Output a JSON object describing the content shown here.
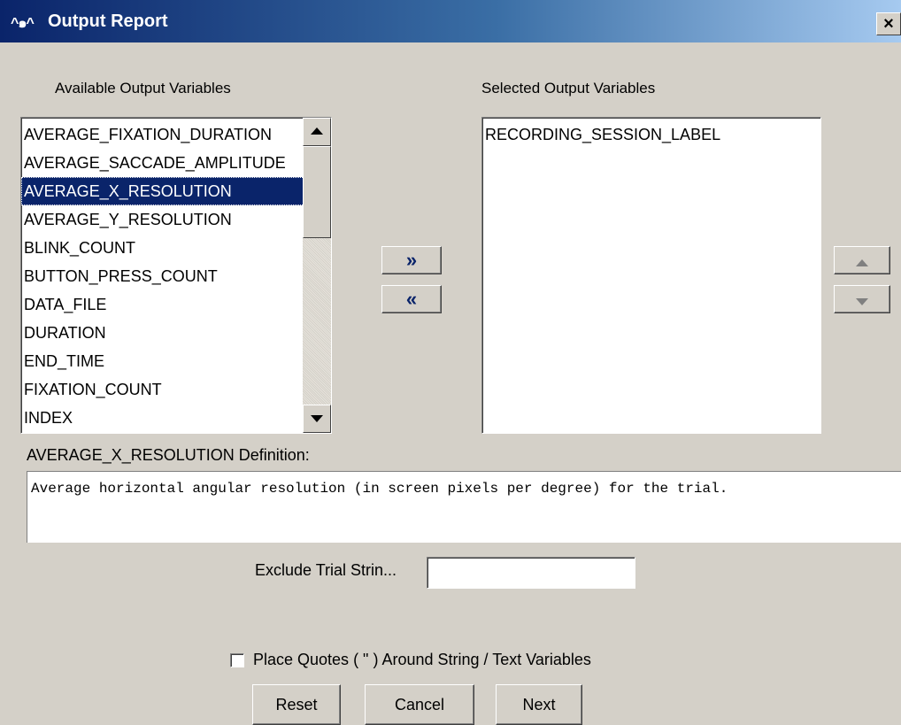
{
  "window": {
    "title": "Output Report",
    "icon_glyph": "^๑^",
    "close_glyph": "×"
  },
  "available": {
    "label": "Available Output Variables",
    "items": [
      "AVERAGE_FIXATION_DURATION",
      "AVERAGE_SACCADE_AMPLITUDE",
      "AVERAGE_X_RESOLUTION",
      "AVERAGE_Y_RESOLUTION",
      "BLINK_COUNT",
      "BUTTON_PRESS_COUNT",
      "DATA_FILE",
      "DURATION",
      "END_TIME",
      "FIXATION_COUNT",
      "INDEX"
    ],
    "selected_index": 2
  },
  "selected": {
    "label": "Selected Output Variables",
    "items": [
      "RECORDING_SESSION_LABEL"
    ]
  },
  "transfer": {
    "add_glyph": "»",
    "remove_glyph": "«"
  },
  "definition": {
    "label": "AVERAGE_X_RESOLUTION Definition:",
    "text": "Average horizontal angular resolution (in screen pixels per degree) for the trial."
  },
  "exclude": {
    "label": "Exclude Trial Strin...",
    "value": ""
  },
  "quotes_option": {
    "label": "Place Quotes ( \" ) Around String /  Text Variables",
    "checked": false
  },
  "buttons": {
    "reset": "Reset",
    "cancel": "Cancel",
    "next": "Next"
  },
  "colors": {
    "dialog_bg": "#d4d0c8",
    "title_gradient_start": "#0a246a",
    "selection_bg": "#0a246a"
  }
}
